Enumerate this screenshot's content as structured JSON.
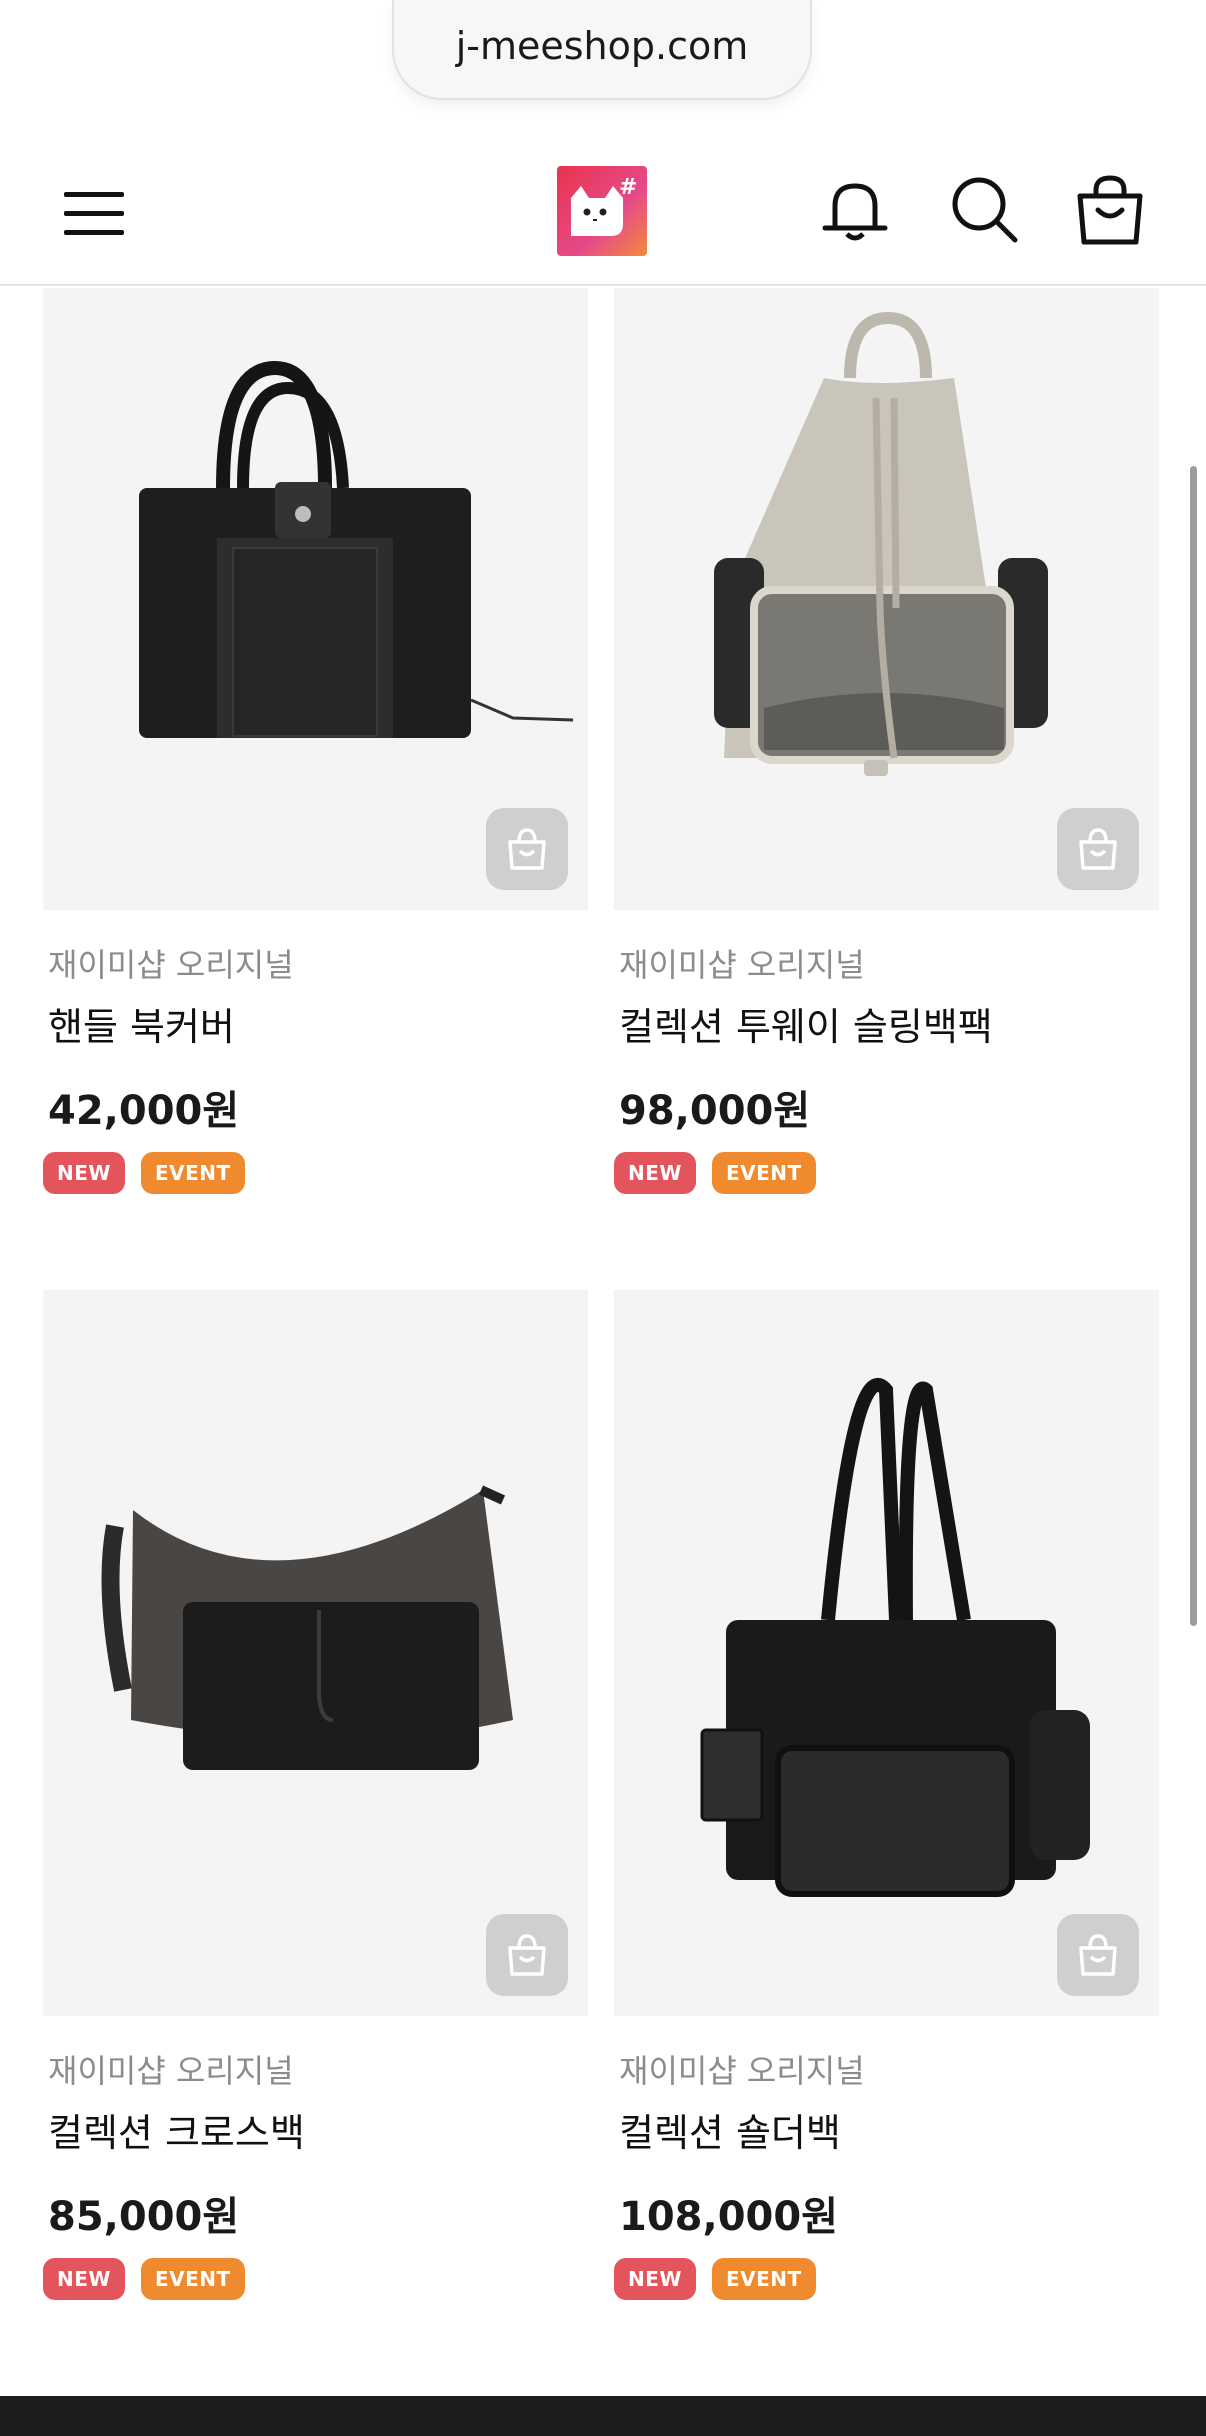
{
  "browser": {
    "url": "j-meeshop.com"
  },
  "header": {
    "menu_icon": "hamburger-menu-icon",
    "logo_icon": "cat-hashtag-logo",
    "notification_icon": "bell-icon",
    "search_icon": "search-icon",
    "cart_icon": "shopping-bag-icon",
    "logo_colors": [
      "#e8344c",
      "#f28a3a",
      "#e64a8a"
    ]
  },
  "products": [
    {
      "brand": "재이미샵 오리지널",
      "name": "핸들 북커버",
      "price": "42,000원",
      "badges": [
        "NEW",
        "EVENT"
      ],
      "cart_icon": "cart-add-icon"
    },
    {
      "brand": "재이미샵 오리지널",
      "name": "컬렉션 투웨이 슬링백팩",
      "price": "98,000원",
      "badges": [
        "NEW",
        "EVENT"
      ],
      "cart_icon": "cart-add-icon"
    },
    {
      "brand": "재이미샵 오리지널",
      "name": "컬렉션 크로스백",
      "price": "85,000원",
      "badges": [
        "NEW",
        "EVENT"
      ],
      "cart_icon": "cart-add-icon"
    },
    {
      "brand": "재이미샵 오리지널",
      "name": "컬렉션 숄더백",
      "price": "108,000원",
      "badges": [
        "NEW",
        "EVENT"
      ],
      "cart_icon": "cart-add-icon"
    }
  ],
  "colors": {
    "badge_new": "#e3545c",
    "badge_event": "#ef8a2e",
    "thumb_bg": "#f4f4f4"
  }
}
